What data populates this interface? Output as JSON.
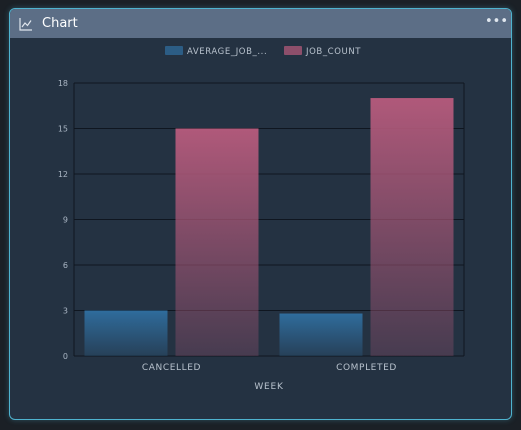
{
  "panel": {
    "title": "Chart",
    "title_icon": "line-chart-icon",
    "menu_icon": "more-horizontal-icon",
    "menu_glyph": "•••"
  },
  "colors": {
    "panel_bg": "#243242",
    "header_bg": "#5c6e86",
    "border": "#4fb3cf",
    "average_job_bar": "#2f6c9c",
    "job_count_bar": "#b0597a"
  },
  "chart_data": {
    "type": "bar",
    "categories": [
      "CANCELLED",
      "COMPLETED"
    ],
    "series": [
      {
        "name": "AVERAGE_JOB_...",
        "values": [
          3,
          2.8
        ]
      },
      {
        "name": "JOB_COUNT",
        "values": [
          15,
          17
        ]
      }
    ],
    "xlabel": "WEEK",
    "ylabel": "",
    "ylim": [
      0,
      18
    ],
    "yticks": [
      0,
      3,
      6,
      9,
      12,
      15,
      18
    ],
    "grid": true,
    "legend_position": "top-center"
  }
}
